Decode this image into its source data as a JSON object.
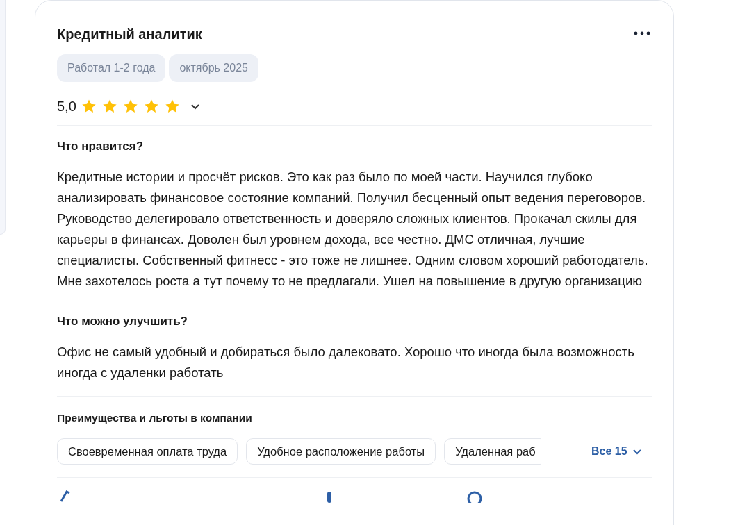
{
  "review": {
    "title": "Кредитный аналитик",
    "tags": [
      "Работал 1-2 года",
      "октябрь 2025"
    ],
    "rating": "5,0",
    "stars": 5,
    "sections": [
      {
        "heading": "Что нравится?",
        "text": "Кредитные истории и просчёт рисков. Это как раз было по моей части. Научился глубоко анализировать финансовое состояние компаний. Получил бесценный опыт ведения переговоров. Руководство делегировало ответственность и доверяло сложных клиентов. Прокачал скилы для карьеры в финансах. Доволен был уровнем дохода, все честно. ДМС отличная, лучшие специалисты. Собственный фитнесс - это тоже не лишнее. Одним словом хороший работодатель. Мне захотелось роста а тут почему то не предлагали. Ушел на повышение в другую организацию"
      },
      {
        "heading": "Что можно улучшить?",
        "text": "Офис не самый удобный и добираться было далековато. Хорошо что иногда была возможность иногда с удаленки работать"
      }
    ],
    "benefits": {
      "heading": "Преимущества и льготы в компании",
      "items": [
        "Своевременная оплата труда",
        "Удобное расположение работы",
        "Удаленная раб"
      ],
      "more": "Все 15"
    }
  }
}
